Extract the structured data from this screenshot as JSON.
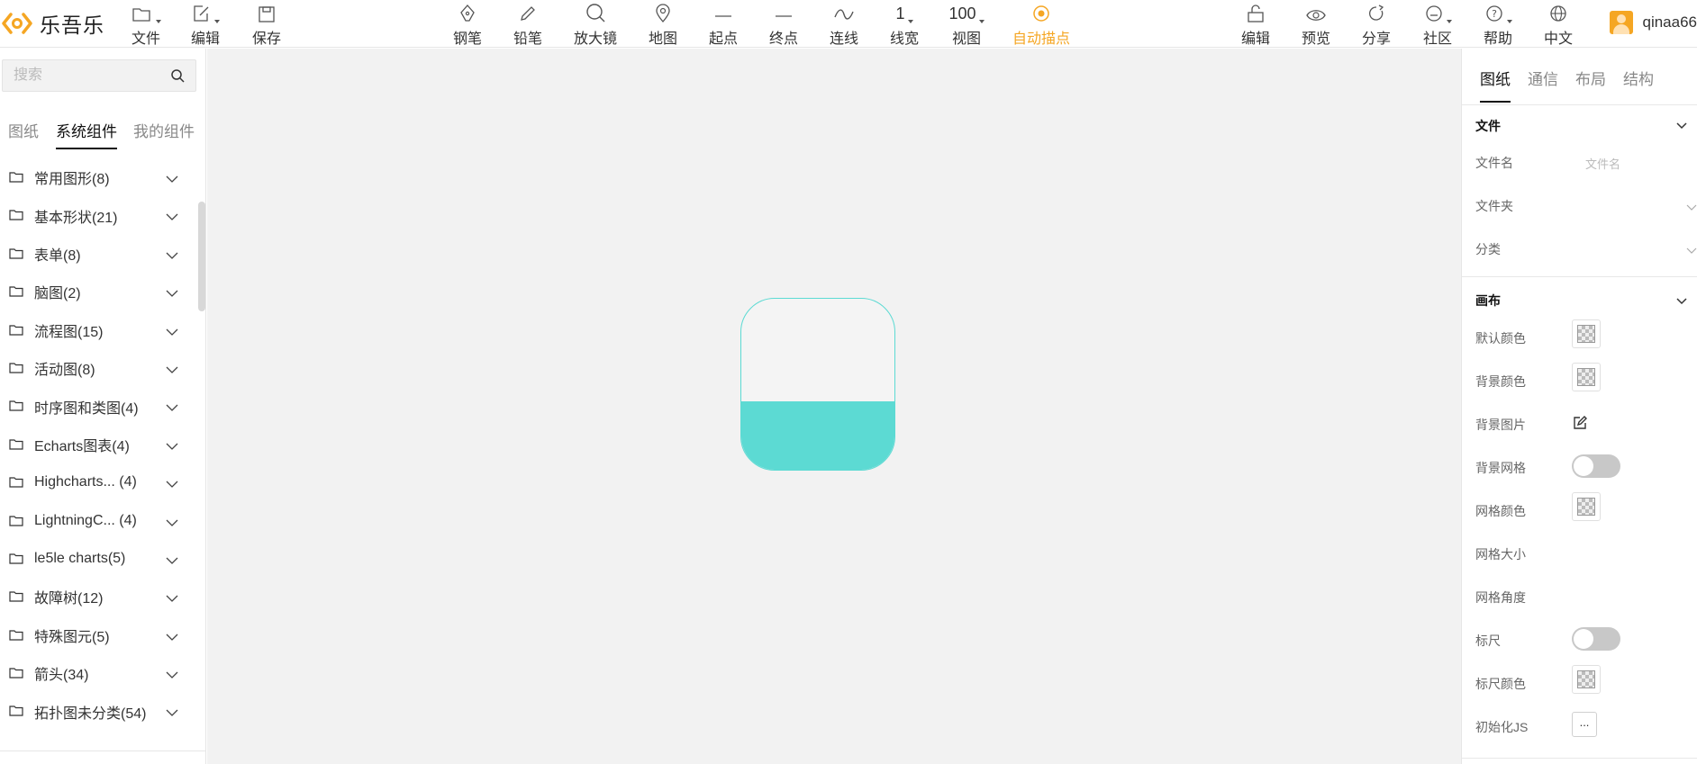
{
  "app": {
    "title": "乐吾乐"
  },
  "toolbar": {
    "file": "文件",
    "edit": "编辑",
    "save": "保存",
    "pen": "钢笔",
    "pencil": "铅笔",
    "magnifier": "放大镜",
    "map": "地图",
    "start": "起点",
    "end": "终点",
    "line": "连线",
    "line_width_value": "1",
    "line_width": "线宽",
    "zoom_value": "100",
    "view": "视图",
    "auto_anchor": "自动描点",
    "edit_right": "编辑",
    "preview": "预览",
    "share": "分享",
    "community": "社区",
    "help": "帮助",
    "language": "中文",
    "username": "qinaa66"
  },
  "colors": {
    "accent": "#f5a623",
    "shape": "#5cdad3",
    "canvas": "#f2f2f2"
  },
  "left": {
    "search_placeholder": "搜索",
    "tabs": [
      "图纸",
      "系统组件",
      "我的组件"
    ],
    "active_tab": 1,
    "categories": [
      "常用图形(8)",
      "基本形状(21)",
      "表单(8)",
      "脑图(2)",
      "流程图(15)",
      "活动图(8)",
      "时序图和类图(4)",
      "Echarts图表(4)",
      "Highcharts...  (4)",
      "LightningC...  (4)",
      "le5le charts(5)",
      "故障树(12)",
      "特殊图元(5)",
      "箭头(34)",
      "拓扑图未分类(54)"
    ]
  },
  "canvas": {
    "liquid_level": 0.4
  },
  "right": {
    "tabs": [
      "图纸",
      "通信",
      "布局",
      "结构"
    ],
    "active_tab": 0,
    "file_section": "文件",
    "file_name_label": "文件名",
    "file_name_placeholder": "文件名",
    "folder_label": "文件夹",
    "category_label": "分类",
    "canvas_section": "画布",
    "default_color": "默认颜色",
    "background_color": "背景颜色",
    "background_image": "背景图片",
    "background_grid": "背景网格",
    "grid_color": "网格颜色",
    "grid_size": "网格大小",
    "grid_angle": "网格角度",
    "ruler": "标尺",
    "ruler_color": "标尺颜色",
    "init_js": "初始化JS",
    "more_button": "..."
  }
}
